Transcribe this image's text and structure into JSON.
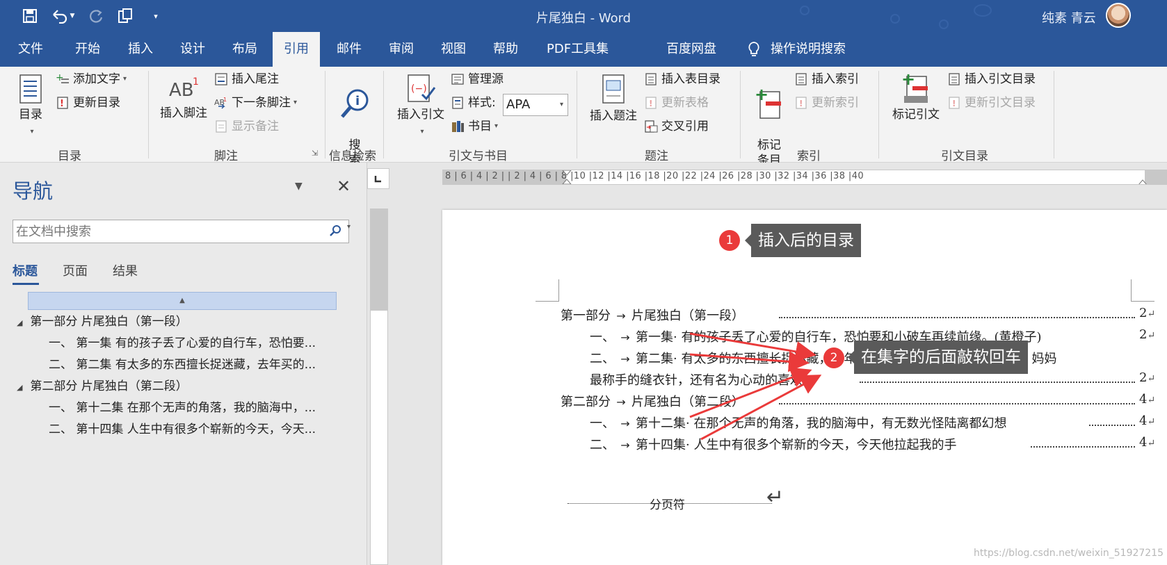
{
  "window": {
    "title": "片尾独白  -  Word",
    "user": "纯素 青云"
  },
  "tabs": [
    "文件",
    "开始",
    "插入",
    "设计",
    "布局",
    "引用",
    "邮件",
    "审阅",
    "视图",
    "帮助",
    "PDF工具集",
    "百度网盘"
  ],
  "active_tab": "引用",
  "tell_me": "操作说明搜索",
  "ribbon": {
    "toc": {
      "big": "目录",
      "add_text": "添加文字",
      "update": "更新目录",
      "group": "目录"
    },
    "footnotes": {
      "insert_footnote": "插入脚注",
      "insert_endnote": "插入尾注",
      "next_footnote": "下一条脚注",
      "show_notes": "显示备注",
      "group": "脚注"
    },
    "research": {
      "search": "搜\n索",
      "group": "信息检索"
    },
    "citations": {
      "insert_citation": "插入引文",
      "manage_sources": "管理源",
      "style_label": "样式:",
      "style_value": "APA",
      "bibliography": "书目",
      "group": "引文与书目"
    },
    "captions": {
      "insert_caption": "插入题注",
      "insert_table_of_figures": "插入表目录",
      "update_table": "更新表格",
      "cross_reference": "交叉引用",
      "group": "题注"
    },
    "index": {
      "mark_entry": "标记\n条目",
      "insert_index": "插入索引",
      "update_index": "更新索引",
      "group": "索引"
    },
    "authorities": {
      "mark_citation": "标记引文",
      "insert_toa": "插入引文目录",
      "update_toa": "更新引文目录",
      "group": "引文目录"
    }
  },
  "nav": {
    "title": "导航",
    "search_placeholder": "在文档中搜索",
    "tabs": [
      "标题",
      "页面",
      "结果"
    ],
    "headings": [
      {
        "level": 1,
        "text": "第一部分 片尾独白（第一段）"
      },
      {
        "level": 2,
        "text": "一、 第一集 有的孩子丢了心爱的自行车，恐怕要..."
      },
      {
        "level": 2,
        "text": "二、 第二集 有太多的东西擅长捉迷藏，去年买的..."
      },
      {
        "level": 1,
        "text": "第二部分 片尾独白（第二段）"
      },
      {
        "level": 2,
        "text": "一、 第十二集 在那个无声的角落，我的脑海中，..."
      },
      {
        "level": 2,
        "text": "二、 第十四集 人生中有很多个崭新的今天，今天..."
      }
    ]
  },
  "ruler": {
    "ticks": "8 | 6 | 4 | 2 |   | 2 | 4 | 6 | 8 |10 |12 |14 |16 |18 |20 |22 |24 |26 |28 |30 |32 |34 |36 |38 |40"
  },
  "document": {
    "toc": [
      {
        "num": "第一部分",
        "title": "片尾独白（第一段）",
        "page": "2"
      },
      {
        "num": "一、",
        "title": "第一集· 有的孩子丢了心爱的自行车，恐怕要和小破车再续前缘。(黄橙子)",
        "page": "2"
      },
      {
        "num": "二、",
        "title": "第二集· 有太多的东西擅长捉迷藏，去年买的旧围巾，刚到手的新橡皮，妈妈",
        "page": ""
      },
      {
        "num": "",
        "title": "最称手的缝衣针，还有名为心动的喜欢。",
        "page": "2"
      },
      {
        "num": "第二部分",
        "title": "片尾独白（第二段）",
        "page": "4"
      },
      {
        "num": "一、",
        "title": "第十二集· 在那个无声的角落，我的脑海中，有无数光怪陆离都幻想",
        "page": "4"
      },
      {
        "num": "二、",
        "title": "第十四集· 人生中有很多个崭新的今天，今天他拉起我的手",
        "page": "4"
      }
    ],
    "callouts": [
      {
        "num": "1",
        "text": "插入后的目录"
      },
      {
        "num": "2",
        "text": "在集字的后面敲软回车"
      }
    ],
    "page_break": "分页符"
  },
  "watermark": "https://blog.csdn.net/weixin_51927215"
}
